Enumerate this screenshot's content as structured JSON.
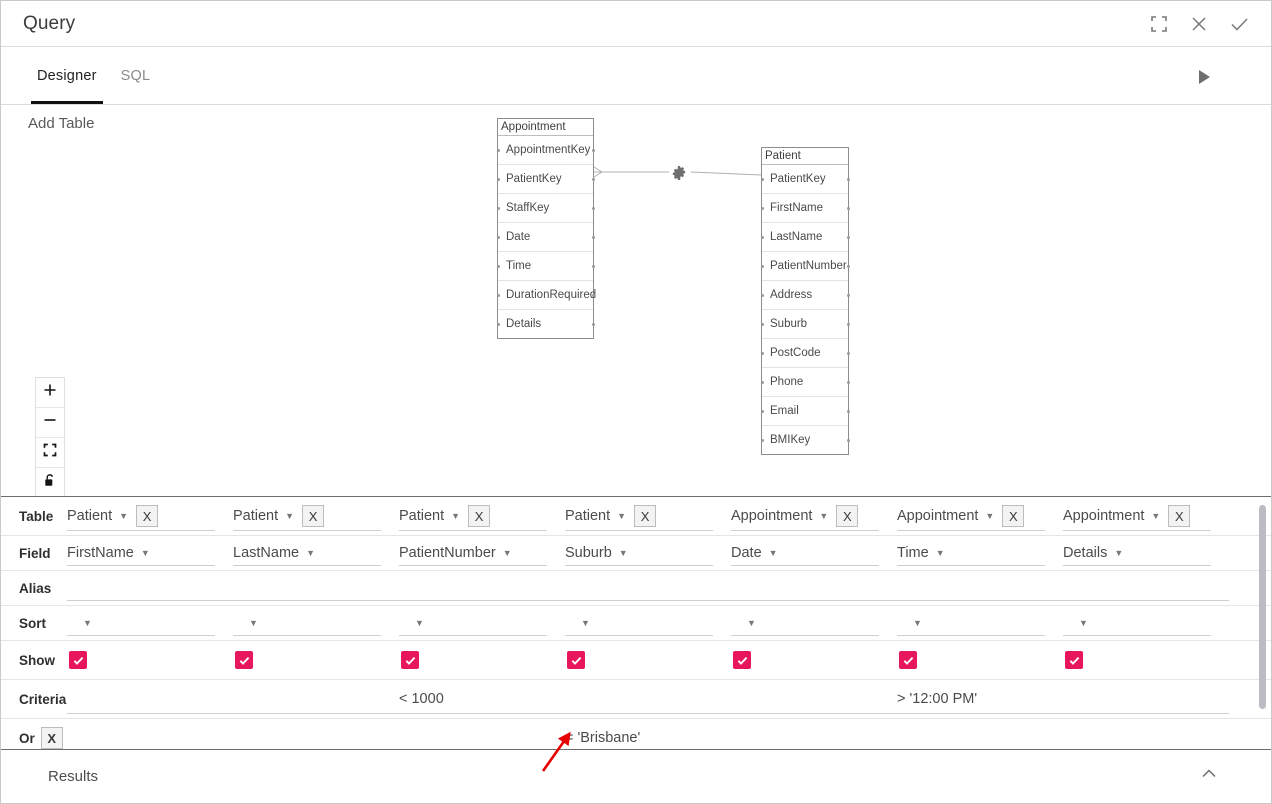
{
  "window": {
    "title": "Query",
    "controls": [
      {
        "name": "maximize-icon",
        "label": "Maximize"
      },
      {
        "name": "close-icon",
        "label": "Close"
      },
      {
        "name": "confirm-icon",
        "label": "Confirm"
      }
    ]
  },
  "tabs": [
    {
      "label": "Designer",
      "active": true
    },
    {
      "label": "SQL",
      "active": false
    }
  ],
  "toolbar": {
    "run_label": "Run",
    "add_table_label": "Add Table"
  },
  "zoom_toolbar": [
    {
      "name": "zoom-in-icon",
      "label": "+"
    },
    {
      "name": "zoom-out-icon",
      "label": "−"
    },
    {
      "name": "fit-to-screen-icon",
      "label": "Fit"
    },
    {
      "name": "lock-icon",
      "label": "Lock"
    }
  ],
  "diagram": {
    "entities": [
      {
        "name": "Appointment",
        "fields": [
          "AppointmentKey",
          "PatientKey",
          "StaffKey",
          "Date",
          "Time",
          "DurationRequired",
          "Details"
        ]
      },
      {
        "name": "Patient",
        "fields": [
          "PatientKey",
          "FirstName",
          "LastName",
          "PatientNumber",
          "Address",
          "Suburb",
          "PostCode",
          "Phone",
          "Email",
          "BMIKey"
        ]
      }
    ],
    "join": {
      "from_entity": "Appointment",
      "from_field": "PatientKey",
      "to_entity": "Patient",
      "to_field": "PatientKey",
      "icon": "gear-icon"
    }
  },
  "grid": {
    "row_labels": {
      "table": "Table",
      "field": "Field",
      "alias": "Alias",
      "sort": "Sort",
      "show": "Show",
      "criteria": "Criteria",
      "or": "Or"
    },
    "remove_label": "X",
    "columns": [
      {
        "table": "Patient",
        "field": "FirstName",
        "alias": "",
        "sort": "",
        "show": true,
        "criteria": "",
        "or": ""
      },
      {
        "table": "Patient",
        "field": "LastName",
        "alias": "",
        "sort": "",
        "show": true,
        "criteria": "",
        "or": ""
      },
      {
        "table": "Patient",
        "field": "PatientNumber",
        "alias": "",
        "sort": "",
        "show": true,
        "criteria": "< 1000",
        "or": ""
      },
      {
        "table": "Patient",
        "field": "Suburb",
        "alias": "",
        "sort": "",
        "show": true,
        "criteria": "",
        "or": "= 'Brisbane'"
      },
      {
        "table": "Appointment",
        "field": "Date",
        "alias": "",
        "sort": "",
        "show": true,
        "criteria": "",
        "or": ""
      },
      {
        "table": "Appointment",
        "field": "Time",
        "alias": "",
        "sort": "",
        "show": true,
        "criteria": "> '12:00 PM'",
        "or": ""
      },
      {
        "table": "Appointment",
        "field": "Details",
        "alias": "",
        "sort": "",
        "show": true,
        "criteria": "",
        "or": ""
      }
    ],
    "focused_cell": {
      "row": "or",
      "column_index": 3
    }
  },
  "footer": {
    "results_label": "Results",
    "collapse_icon": "chevron-up-icon"
  },
  "colors": {
    "checkbox": "#e8175d",
    "focus_underline": "#1769d1",
    "annotation_arrow": "#e80000",
    "tab_indicator": "#111111",
    "border": "#dcdcdc"
  }
}
